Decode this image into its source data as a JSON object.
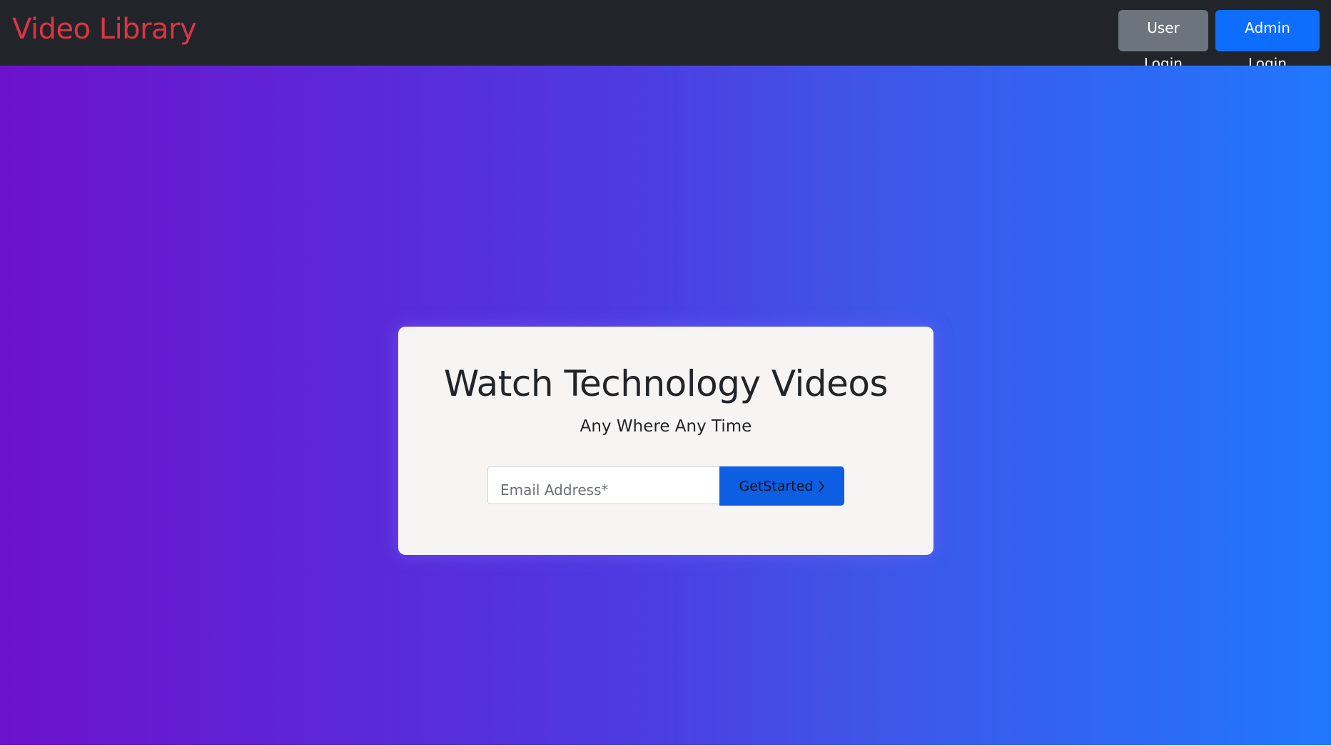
{
  "navbar": {
    "brand": "Video Library",
    "user_login_label": "User Login",
    "admin_login_label": "Admin Login"
  },
  "hero": {
    "title": "Watch Technology Videos",
    "subtitle": "Any Where Any Time",
    "email_placeholder": "Email Address*",
    "email_value": "",
    "get_started_label": "GetStarted",
    "get_started_icon": "chevron-right-icon"
  },
  "colors": {
    "navbar_bg": "#212529",
    "brand": "#dc3545",
    "user_login_bg": "#6c757d",
    "admin_login_bg": "#0d6efd",
    "gradient_start": "#6d12cc",
    "gradient_end": "#2077fd",
    "card_bg": "#f7f5f4",
    "get_started_bg": "#0d5ee3"
  }
}
